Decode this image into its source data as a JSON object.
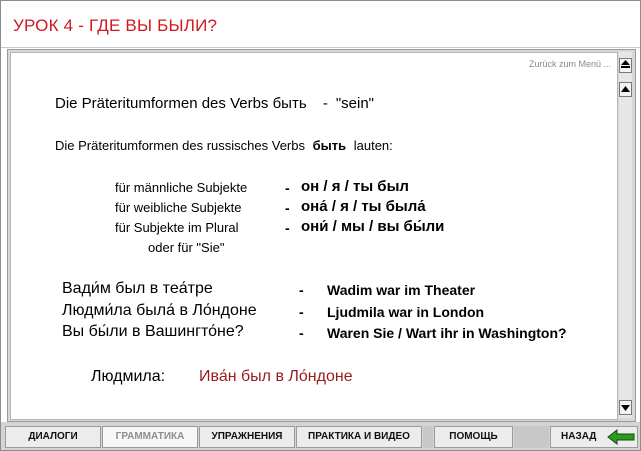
{
  "header": {
    "lesson_title": "УРОК 4  - ГДЕ ВЫ БЫЛИ?"
  },
  "toplink": {
    "back_menu": "Zurück zum Menü ..."
  },
  "grammar": {
    "heading": "Die Präteritumformen des Verbs",
    "heading_verb": "быть",
    "heading_dash": "-",
    "heading_translation": "\"sein\"",
    "intro_before": "Die Präteritumformen des russisches Verbs",
    "intro_verb": "быть",
    "intro_after": "lauten:",
    "forms": [
      {
        "label": "für männliche Subjekte",
        "dash": "-",
        "value": "он / я / ты  был"
      },
      {
        "label": "für weibliche Subjekte",
        "dash": "-",
        "value": "она́ / я / ты была́"
      },
      {
        "label": "für Subjekte im Plural",
        "label2": "oder für \"Sie\"",
        "dash": "-",
        "value": "они́ / мы / вы бы́ли"
      }
    ],
    "examples": [
      {
        "ru": "Вади́м был в теа́тре",
        "dash": "-",
        "de": "Wadim war im Theater"
      },
      {
        "ru": "Людми́ла была́ в Ло́ндоне",
        "dash": "-",
        "de": "Ljudmila war in London"
      },
      {
        "ru": "Вы бы́ли в Вашингто́не?",
        "dash": "-",
        "de": "Waren Sie / Wart ihr in Washington?"
      }
    ],
    "dialog": {
      "speaker": "Людмила:",
      "text": "Ива́н был в Ло́ндоне"
    }
  },
  "nav": {
    "dialogs": "ДИАЛОГИ",
    "grammar": "ГРАММАТИКА",
    "exercises": "УПРАЖНЕНИЯ",
    "practice": "ПРАКТИКА И ВИДЕО",
    "help": "ПОМОЩЬ",
    "back": "НАЗАД"
  },
  "colors": {
    "accent_red": "#d0181f",
    "dialog_text": "#9b1b1b",
    "back_arrow": "#2e9a1e"
  },
  "icons": {
    "scroll_top": "double-up-arrow-icon",
    "scroll_up": "up-arrow-icon",
    "scroll_down": "down-arrow-icon",
    "back": "green-left-arrow-icon"
  }
}
